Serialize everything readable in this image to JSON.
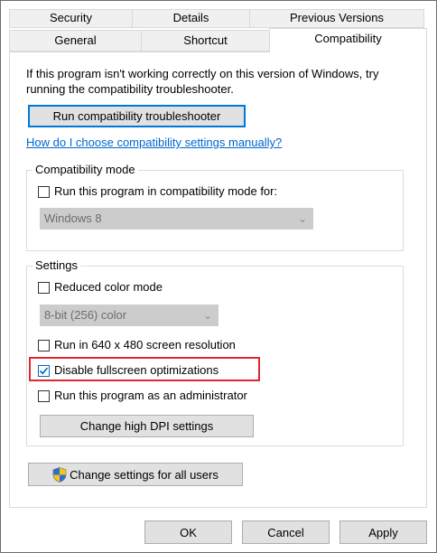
{
  "tabs": {
    "row1": [
      "Security",
      "Details",
      "Previous Versions"
    ],
    "row2": [
      "General",
      "Shortcut",
      "Compatibility"
    ]
  },
  "intro_text_line1": "If this program isn't working correctly on this version of Windows, try",
  "intro_text_line2": "running the compatibility troubleshooter.",
  "run_troubleshooter_label": "Run compatibility troubleshooter",
  "how_link": "How do I choose compatibility settings manually?",
  "compat_mode": {
    "title": "Compatibility mode",
    "checkbox_label": "Run this program in compatibility mode for:",
    "checked": false,
    "os_select_value": "Windows 8"
  },
  "settings": {
    "title": "Settings",
    "reduced_color_label": "Reduced color mode",
    "reduced_color_checked": false,
    "color_select_value": "8-bit (256) color",
    "res_640_label": "Run in 640 x 480 screen resolution",
    "res_640_checked": false,
    "disable_fullscreen_label": "Disable fullscreen optimizations",
    "disable_fullscreen_checked": true,
    "run_as_admin_label": "Run this program as an administrator",
    "run_as_admin_checked": false,
    "change_dpi_label": "Change high DPI settings"
  },
  "change_all_users_label": "Change settings for all users",
  "footer": {
    "ok": "OK",
    "cancel": "Cancel",
    "apply": "Apply"
  },
  "colors": {
    "link": "#0066cc",
    "highlight": "#e0282e",
    "accent": "#0078d7"
  }
}
